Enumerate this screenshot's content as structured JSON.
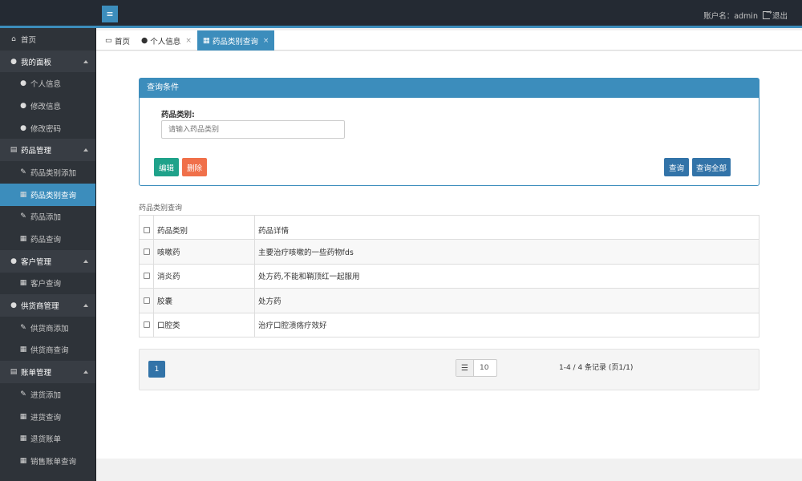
{
  "topbar": {
    "menu_icon": "≡",
    "account_label": "账户名：admin",
    "logout_label": "退出",
    "accent": "#3c8dbc"
  },
  "sidebar": {
    "home": "首页",
    "groups": [
      {
        "label": "我的面板",
        "icon": "user-icon",
        "items": [
          "个人信息",
          "修改信息",
          "修改密码"
        ]
      },
      {
        "label": "药品管理",
        "icon": "document-icon",
        "items": [
          "药品类别添加",
          "药品类别查询",
          "药品添加",
          "药品查询"
        ]
      },
      {
        "label": "客户管理",
        "icon": "users-icon",
        "items": [
          "客户查询"
        ]
      },
      {
        "label": "供货商管理",
        "icon": "users-icon",
        "items": [
          "供货商添加",
          "供货商查询"
        ]
      },
      {
        "label": "账单管理",
        "icon": "document-icon",
        "items": [
          "进货添加",
          "进货查询",
          "退货账单",
          "销售账单查询"
        ]
      }
    ],
    "active_item": "药品类别查询"
  },
  "tabs": [
    {
      "label": "首页",
      "icon": "monitor-icon",
      "active": false,
      "closable": false
    },
    {
      "label": "个人信息",
      "icon": "user-icon",
      "active": false,
      "closable": true
    },
    {
      "label": "药品类别查询",
      "icon": "search-doc-icon",
      "active": true,
      "closable": true
    }
  ],
  "query_panel": {
    "title": "查询条件",
    "field_label": "药品类别:",
    "field_placeholder": "请输入药品类别",
    "field_value": "",
    "edit_button": "编辑",
    "delete_button": "删除",
    "query_button": "查询",
    "query_all_button": "查询全部"
  },
  "table": {
    "title": "药品类别查询",
    "columns": [
      "药品类别",
      "药品详情"
    ],
    "rows": [
      [
        "咳嗽药",
        "主要治疗咳嗽的一些药物fds"
      ],
      [
        "消炎药",
        "处方药,不能和鞘顶红一起服用"
      ],
      [
        "胶囊",
        "处方药"
      ],
      [
        "口腔类",
        "治疗口腔溃疡疗效好"
      ]
    ]
  },
  "pager": {
    "current_page": "1",
    "page_size": "10",
    "summary": "1-4 / 4 条记录 (页1/1)"
  }
}
